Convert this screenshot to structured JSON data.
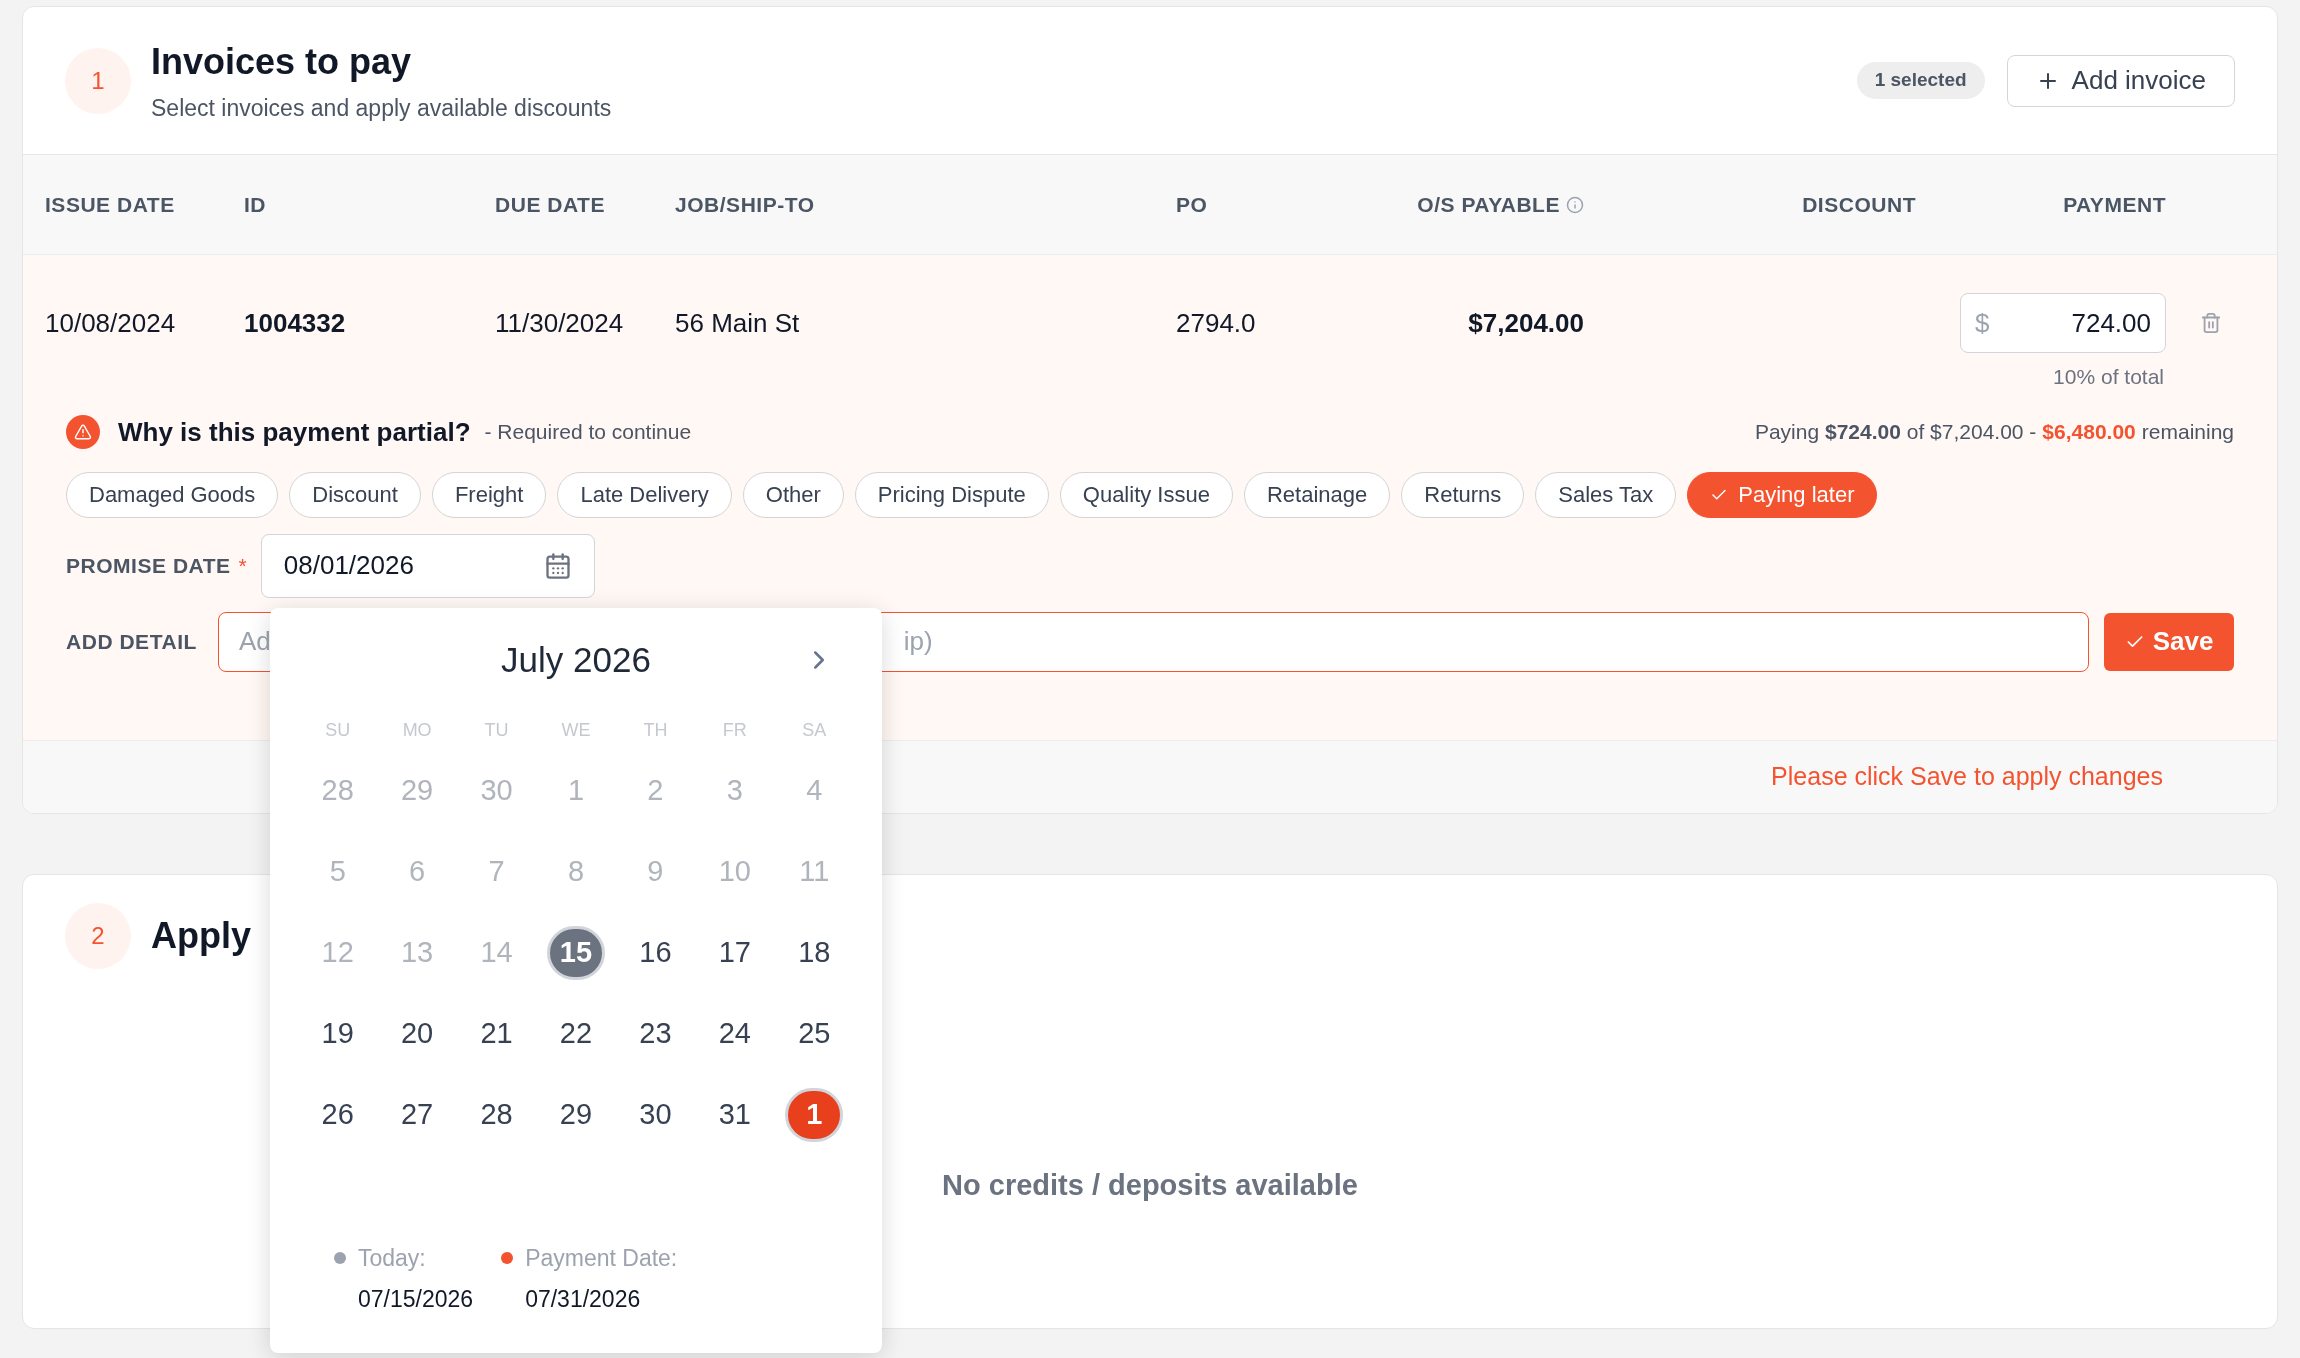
{
  "invoices_card": {
    "step": "1",
    "title": "Invoices to pay",
    "subtitle": "Select invoices and apply available discounts",
    "selected_badge": "1 selected",
    "add_button": "Add invoice",
    "columns": [
      "ISSUE DATE",
      "ID",
      "DUE DATE",
      "JOB/SHIP-TO",
      "PO",
      "O/S PAYABLE",
      "DISCOUNT",
      "PAYMENT"
    ],
    "row": {
      "issue_date": "10/08/2024",
      "id": "1004332",
      "due_date": "11/30/2024",
      "job": "56 Main St",
      "po": "2794.0",
      "payable": "$7,204.00",
      "currency": "$",
      "payment": "724.00",
      "share": "10% of total"
    },
    "partial": {
      "question": "Why is this payment partial?",
      "required": "- Required to continue",
      "summary": "Paying **$724.00** of $7,204.00 -",
      "remaining_amount": "$6,480.00",
      "remaining_word": "remaining",
      "reasons": [
        {
          "label": "Damaged Goods",
          "selected": false
        },
        {
          "label": "Discount",
          "selected": false
        },
        {
          "label": "Freight",
          "selected": false
        },
        {
          "label": "Late Delivery",
          "selected": false
        },
        {
          "label": "Other",
          "selected": false
        },
        {
          "label": "Pricing Dispute",
          "selected": false
        },
        {
          "label": "Quality Issue",
          "selected": false
        },
        {
          "label": "Retainage",
          "selected": false
        },
        {
          "label": "Returns",
          "selected": false
        },
        {
          "label": "Sales Tax",
          "selected": false
        },
        {
          "label": "Paying later",
          "selected": true
        }
      ],
      "promise_label": "PROMISE DATE",
      "required_mark": "*",
      "promise_value": "08/01/2026",
      "detail_label": "ADD DETAIL",
      "detail_placeholder_start": "Ad",
      "detail_placeholder_end": "ip)",
      "save": "Save"
    },
    "footer_note": "Please click Save to apply changes"
  },
  "credits_card": {
    "step": "2",
    "title": "Apply",
    "empty": "No credits / deposits available"
  },
  "calendar": {
    "month": "July 2026",
    "weekdays": [
      "SU",
      "MO",
      "TU",
      "WE",
      "TH",
      "FR",
      "SA"
    ],
    "days": [
      {
        "label": "28",
        "muted": true,
        "today": false,
        "selected": false
      },
      {
        "label": "29",
        "muted": true,
        "today": false,
        "selected": false
      },
      {
        "label": "30",
        "muted": true,
        "today": false,
        "selected": false
      },
      {
        "label": "1",
        "muted": true,
        "today": false,
        "selected": false
      },
      {
        "label": "2",
        "muted": true,
        "today": false,
        "selected": false
      },
      {
        "label": "3",
        "muted": true,
        "today": false,
        "selected": false
      },
      {
        "label": "4",
        "muted": true,
        "today": false,
        "selected": false
      },
      {
        "label": "5",
        "muted": true,
        "today": false,
        "selected": false
      },
      {
        "label": "6",
        "muted": true,
        "today": false,
        "selected": false
      },
      {
        "label": "7",
        "muted": true,
        "today": false,
        "selected": false
      },
      {
        "label": "8",
        "muted": true,
        "today": false,
        "selected": false
      },
      {
        "label": "9",
        "muted": true,
        "today": false,
        "selected": false
      },
      {
        "label": "10",
        "muted": true,
        "today": false,
        "selected": false
      },
      {
        "label": "11",
        "muted": true,
        "today": false,
        "selected": false
      },
      {
        "label": "12",
        "muted": true,
        "today": false,
        "selected": false
      },
      {
        "label": "13",
        "muted": true,
        "today": false,
        "selected": false
      },
      {
        "label": "14",
        "muted": true,
        "today": false,
        "selected": false
      },
      {
        "label": "15",
        "muted": false,
        "today": true,
        "selected": false
      },
      {
        "label": "16",
        "muted": false,
        "today": false,
        "selected": false
      },
      {
        "label": "17",
        "muted": false,
        "today": false,
        "selected": false
      },
      {
        "label": "18",
        "muted": false,
        "today": false,
        "selected": false
      },
      {
        "label": "19",
        "muted": false,
        "today": false,
        "selected": false
      },
      {
        "label": "20",
        "muted": false,
        "today": false,
        "selected": false
      },
      {
        "label": "21",
        "muted": false,
        "today": false,
        "selected": false
      },
      {
        "label": "22",
        "muted": false,
        "today": false,
        "selected": false
      },
      {
        "label": "23",
        "muted": false,
        "today": false,
        "selected": false
      },
      {
        "label": "24",
        "muted": false,
        "today": false,
        "selected": false
      },
      {
        "label": "25",
        "muted": false,
        "today": false,
        "selected": false
      },
      {
        "label": "26",
        "muted": false,
        "today": false,
        "selected": false
      },
      {
        "label": "27",
        "muted": false,
        "today": false,
        "selected": false
      },
      {
        "label": "28",
        "muted": false,
        "today": false,
        "selected": false
      },
      {
        "label": "29",
        "muted": false,
        "today": false,
        "selected": false
      },
      {
        "label": "30",
        "muted": false,
        "today": false,
        "selected": false
      },
      {
        "label": "31",
        "muted": false,
        "today": false,
        "selected": false
      },
      {
        "label": "1",
        "muted": false,
        "today": false,
        "selected": true
      }
    ],
    "legend": [
      {
        "label": "Today:",
        "date": "07/15/2026",
        "color": "#9ca3af"
      },
      {
        "label": "Payment Date:",
        "date": "07/31/2026",
        "color": "#f4532f"
      }
    ]
  }
}
